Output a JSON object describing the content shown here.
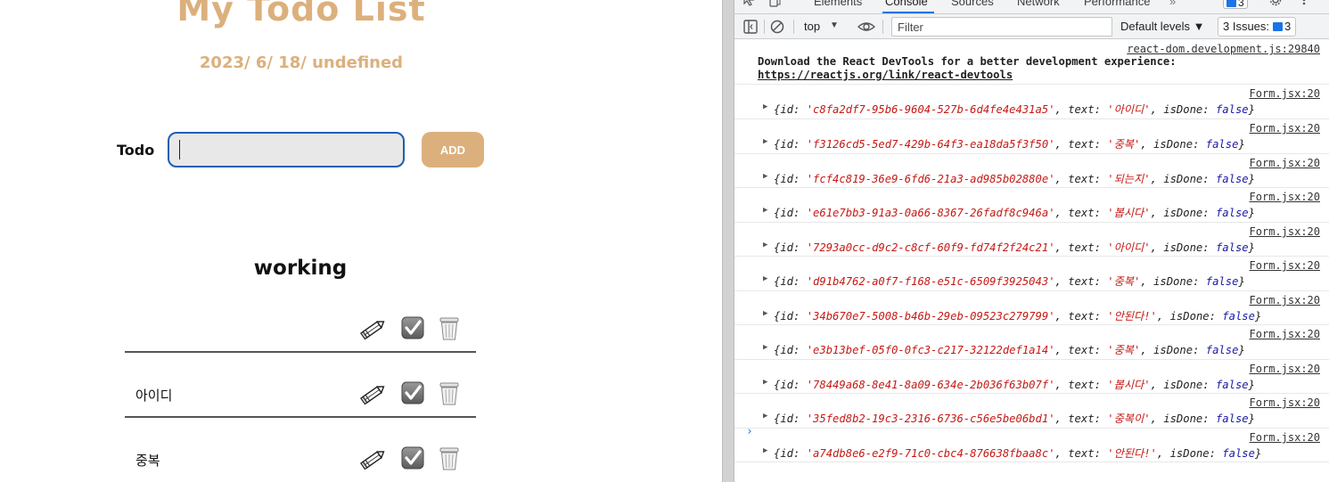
{
  "app": {
    "title": "My Todo List",
    "date": "2023/ 6/ 18/ undefined",
    "input_label": "Todo",
    "input_value": "",
    "add_button": "ADD",
    "section_title": "working",
    "todos": [
      {
        "text": ""
      },
      {
        "text": "아이디"
      },
      {
        "text": "중복"
      }
    ]
  },
  "devtools": {
    "tabs": [
      "Elements",
      "Console",
      "Sources",
      "Network",
      "Performance"
    ],
    "active_tab": "Console",
    "more_tabs": "»",
    "badge_count": "3",
    "context": "top",
    "filter_placeholder": "Filter",
    "levels": "Default levels ▼",
    "issues_label": "3 Issues:",
    "issues_count": "3",
    "messages": {
      "first": {
        "source": "react-dom.development.js:29840",
        "text": "Download the React DevTools for a better development experience: ",
        "link": "https://reactjs.org/link/react-devtools"
      },
      "logs": [
        {
          "source": "Form.jsx:20",
          "id": "'c8fa2df7-95b6-9604-527b-6d4fe4e431a5'",
          "text": "'아이디'",
          "isDone": "false"
        },
        {
          "source": "Form.jsx:20",
          "id": "'f3126cd5-5ed7-429b-64f3-ea18da5f3f50'",
          "text": "'중복'",
          "isDone": "false"
        },
        {
          "source": "Form.jsx:20",
          "id": "'fcf4c819-36e9-6fd6-21a3-ad985b02880e'",
          "text": "'되는지'",
          "isDone": "false"
        },
        {
          "source": "Form.jsx:20",
          "id": "'e61e7bb3-91a3-0a66-8367-26fadf8c946a'",
          "text": "'봅시다'",
          "isDone": "false"
        },
        {
          "source": "Form.jsx:20",
          "id": "'7293a0cc-d9c2-c8cf-60f9-fd74f2f24c21'",
          "text": "'아이디'",
          "isDone": "false"
        },
        {
          "source": "Form.jsx:20",
          "id": "'d91b4762-a0f7-f168-e51c-6509f3925043'",
          "text": "'중복'",
          "isDone": "false"
        },
        {
          "source": "Form.jsx:20",
          "id": "'34b670e7-5008-b46b-29eb-09523c279799'",
          "text": "'안된다!'",
          "isDone": "false"
        },
        {
          "source": "Form.jsx:20",
          "id": "'e3b13bef-05f0-0fc3-c217-32122def1a14'",
          "text": "'중복'",
          "isDone": "false"
        },
        {
          "source": "Form.jsx:20",
          "id": "'78449a68-8e41-8a09-634e-2b036f63b07f'",
          "text": "'봅시다'",
          "isDone": "false"
        },
        {
          "source": "Form.jsx:20",
          "id": "'35fed8b2-19c3-2316-6736-c56e5be06bd1'",
          "text": "'중복이'",
          "isDone": "false"
        },
        {
          "source": "Form.jsx:20",
          "id": "'a74db8e6-e2f9-71c0-cbc4-876638fbaa8c'",
          "text": "'안된다!'",
          "isDone": "false"
        }
      ]
    },
    "prompt": "›"
  },
  "colors": {
    "accent": "#dcb07c",
    "input_border": "#1a5fb4",
    "devtools_blue": "#1a73e8",
    "string_red": "#c41a16",
    "keyword_blue": "#1a1aa6"
  },
  "icons": [
    "pencil-icon",
    "checkbox-icon",
    "trash-icon",
    "dock-icon",
    "clear-console-icon",
    "eye-icon",
    "gear-icon",
    "kebab-icon",
    "inspect-icon",
    "device-icon"
  ]
}
